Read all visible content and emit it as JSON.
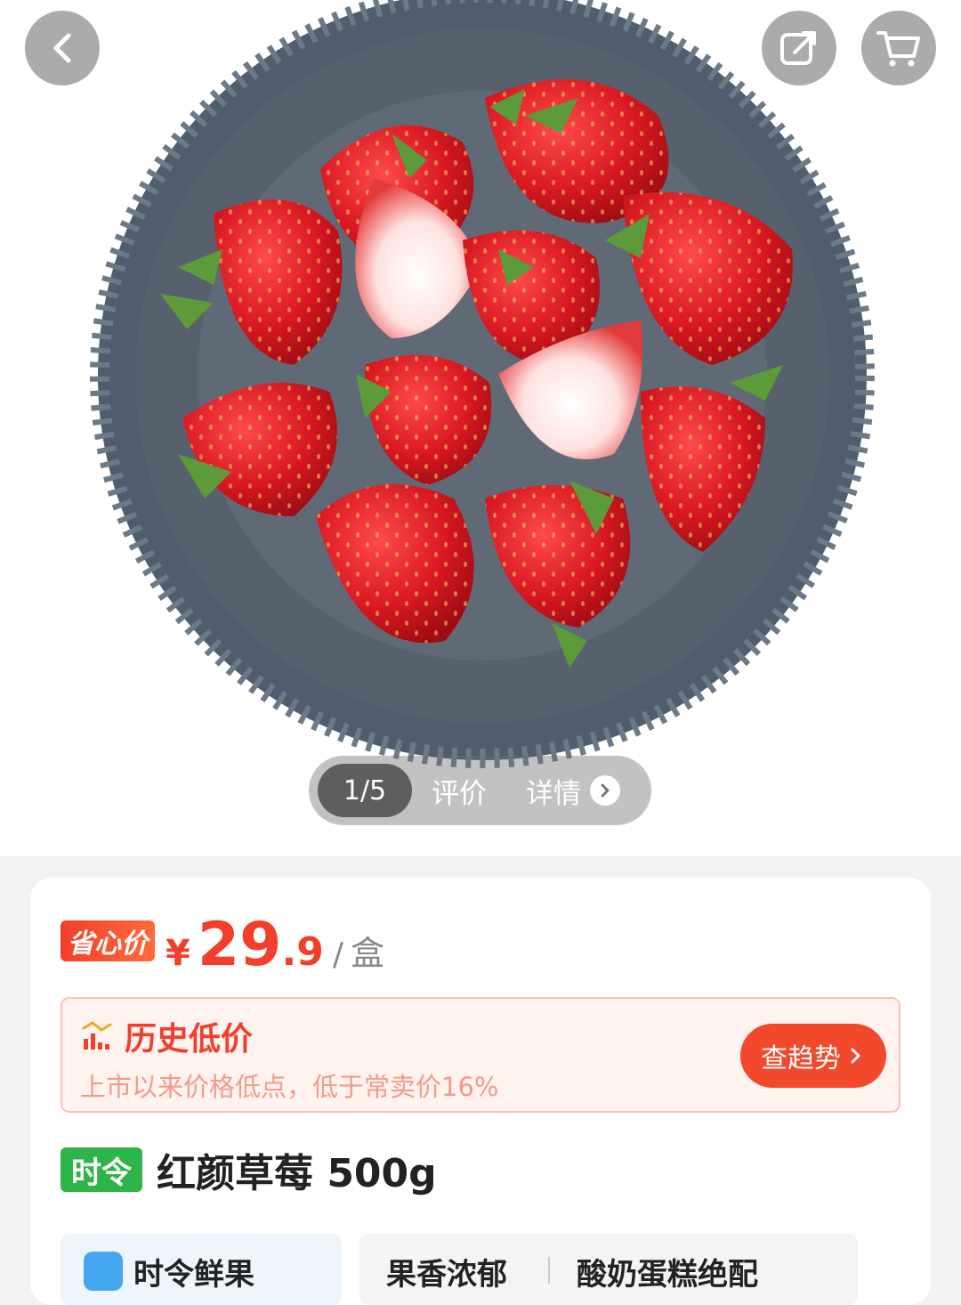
{
  "gallery": {
    "counter": "1/5",
    "reviews_tab": "评价",
    "details_tab": "详情"
  },
  "price": {
    "badge": "省心价",
    "currency": "¥",
    "integer": "29",
    "decimal": ".9",
    "separator": "/",
    "unit": "盒"
  },
  "history": {
    "title": "历史低价",
    "subtitle": "上市以来价格低点，低于常卖价16%",
    "trend_button": "查趋势"
  },
  "product": {
    "season_badge": "时令",
    "title": "红颜草莓 500g"
  },
  "tags": {
    "tag1": "时令鲜果",
    "tag2_a": "果香浓郁",
    "tag2_b": "酸奶蛋糕绝配"
  },
  "colors": {
    "accent": "#f23f2b",
    "season_green": "#2fb44a",
    "history_bg": "#fff3f0"
  },
  "icons": [
    "back-arrow-icon",
    "share-icon",
    "cart-icon",
    "chevron-right-icon",
    "trend-chart-icon"
  ]
}
